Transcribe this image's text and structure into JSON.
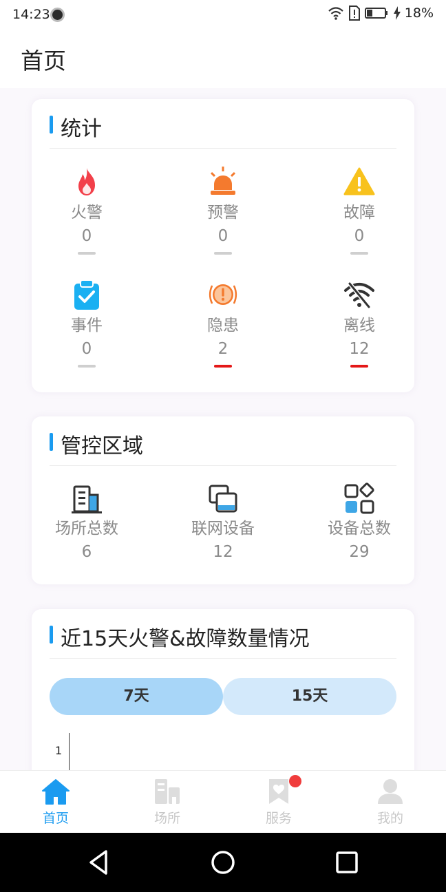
{
  "status_bar": {
    "time": "14:23",
    "battery": "18%"
  },
  "header": {
    "title": "首页"
  },
  "stats": {
    "title": "统计",
    "items": [
      {
        "label": "火警",
        "value": "0",
        "icon": "fire-icon",
        "alert": false
      },
      {
        "label": "预警",
        "value": "0",
        "icon": "alarm-siren-icon",
        "alert": false
      },
      {
        "label": "故障",
        "value": "0",
        "icon": "warning-triangle-icon",
        "alert": false
      },
      {
        "label": "事件",
        "value": "0",
        "icon": "clipboard-check-icon",
        "alert": false
      },
      {
        "label": "隐患",
        "value": "2",
        "icon": "hazard-exclamation-icon",
        "alert": true
      },
      {
        "label": "离线",
        "value": "12",
        "icon": "wifi-off-icon",
        "alert": true
      }
    ]
  },
  "area": {
    "title": "管控区域",
    "items": [
      {
        "label": "场所总数",
        "value": "6",
        "icon": "building-icon"
      },
      {
        "label": "联网设备",
        "value": "12",
        "icon": "devices-icon"
      },
      {
        "label": "设备总数",
        "value": "29",
        "icon": "apps-grid-icon"
      }
    ]
  },
  "trend": {
    "title": "近15天火警&故障数量情况",
    "tabs": [
      "7天",
      "15天"
    ],
    "selected_tab": "7天"
  },
  "chart_data": {
    "type": "line",
    "title": "",
    "y_ticks": [
      "1"
    ]
  },
  "bottom_nav": {
    "items": [
      {
        "label": "首页",
        "icon": "home-icon",
        "active": true
      },
      {
        "label": "场所",
        "icon": "building-icon",
        "active": false
      },
      {
        "label": "服务",
        "icon": "service-bookmark-icon",
        "active": false,
        "badge": true
      },
      {
        "label": "我的",
        "icon": "user-icon",
        "active": false
      }
    ]
  },
  "colors": {
    "accent": "#1a9bf0",
    "alert": "#e41818",
    "tab_selected": "#a8d6f8",
    "tab_normal": "#d3e9fb"
  }
}
